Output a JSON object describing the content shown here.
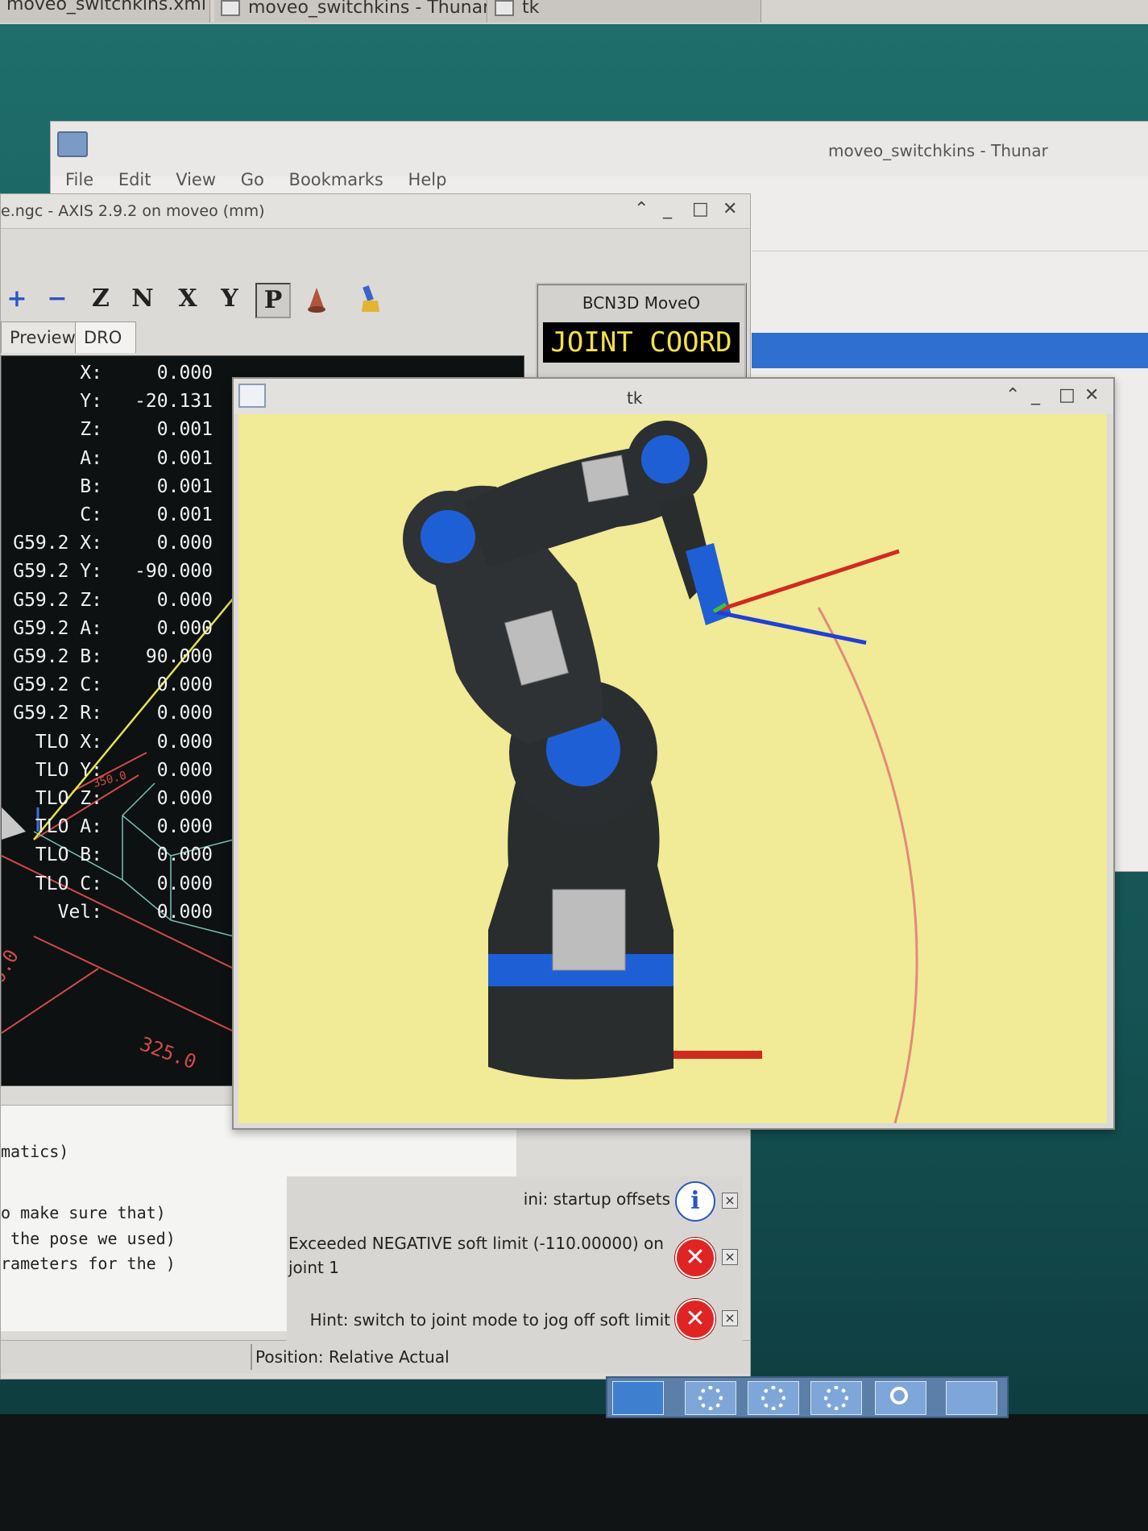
{
  "top_taskbar": {
    "tasks": [
      {
        "label": "moveo_switchkins.xml - /..."
      },
      {
        "label": "moveo_switchkins - Thunar"
      },
      {
        "label": "tk"
      }
    ]
  },
  "thunar": {
    "title": "moveo_switchkins - Thunar",
    "menu": [
      "File",
      "Edit",
      "View",
      "Go",
      "Bookmarks",
      "Help"
    ]
  },
  "axis": {
    "title": "e.ngc - AXIS 2.9.2 on moveo (mm)",
    "toolbar": [
      "+",
      "−",
      "Z",
      "N",
      "X",
      "Y",
      "P"
    ],
    "tabs": [
      "Preview",
      "DRO"
    ],
    "machine_name": "BCN3D MoveO",
    "mode_display": "JOINT COORD",
    "dro_rows": [
      {
        "label": "X:",
        "value": "0.000"
      },
      {
        "label": "Y:",
        "value": "-20.131"
      },
      {
        "label": "Z:",
        "value": "0.001"
      },
      {
        "label": "A:",
        "value": "0.001"
      },
      {
        "label": "B:",
        "value": "0.001"
      },
      {
        "label": "C:",
        "value": "0.001"
      },
      {
        "label": "G59.2 X:",
        "value": "0.000"
      },
      {
        "label": "G59.2 Y:",
        "value": "-90.000"
      },
      {
        "label": "G59.2 Z:",
        "value": "0.000"
      },
      {
        "label": "G59.2 A:",
        "value": "0.000"
      },
      {
        "label": "G59.2 B:",
        "value": "90.000"
      },
      {
        "label": "G59.2 C:",
        "value": "0.000"
      },
      {
        "label": "G59.2 R:",
        "value": "0.000"
      },
      {
        "label": "TLO X:",
        "value": "0.000"
      },
      {
        "label": "TLO Y:",
        "value": "0.000"
      },
      {
        "label": "TLO Z:",
        "value": "0.000"
      },
      {
        "label": "TLO A:",
        "value": "0.000"
      },
      {
        "label": "TLO B:",
        "value": "0.000"
      },
      {
        "label": "TLO C:",
        "value": "0.000"
      },
      {
        "label": "Vel:",
        "value": "0.000"
      }
    ],
    "preview_dimension_labels": [
      "325.0",
      "0.0",
      "350.0"
    ],
    "code_lines": [
      "matics)",
      "o make sure that)",
      " the pose we used)",
      "rameters for the )"
    ],
    "status": "Position: Relative Actual"
  },
  "notifications": [
    {
      "text": "ini: startup offsets",
      "type": "info",
      "icon": "info-icon"
    },
    {
      "text": "Exceeded NEGATIVE soft limit (-110.00000) on joint 1",
      "type": "error",
      "icon": "error-icon"
    },
    {
      "text": "Hint: switch to joint mode to jog off soft limit",
      "type": "error",
      "icon": "error-icon"
    }
  ],
  "tk": {
    "title": "tk"
  },
  "colors": {
    "desktop": "#1d6a6a",
    "canvas": "#f1ea96",
    "robot_body": "#2a2d2e",
    "robot_joint": "#1f5fd6",
    "dro_bg": "#0d1111",
    "mode_text": "#f3e04b"
  }
}
